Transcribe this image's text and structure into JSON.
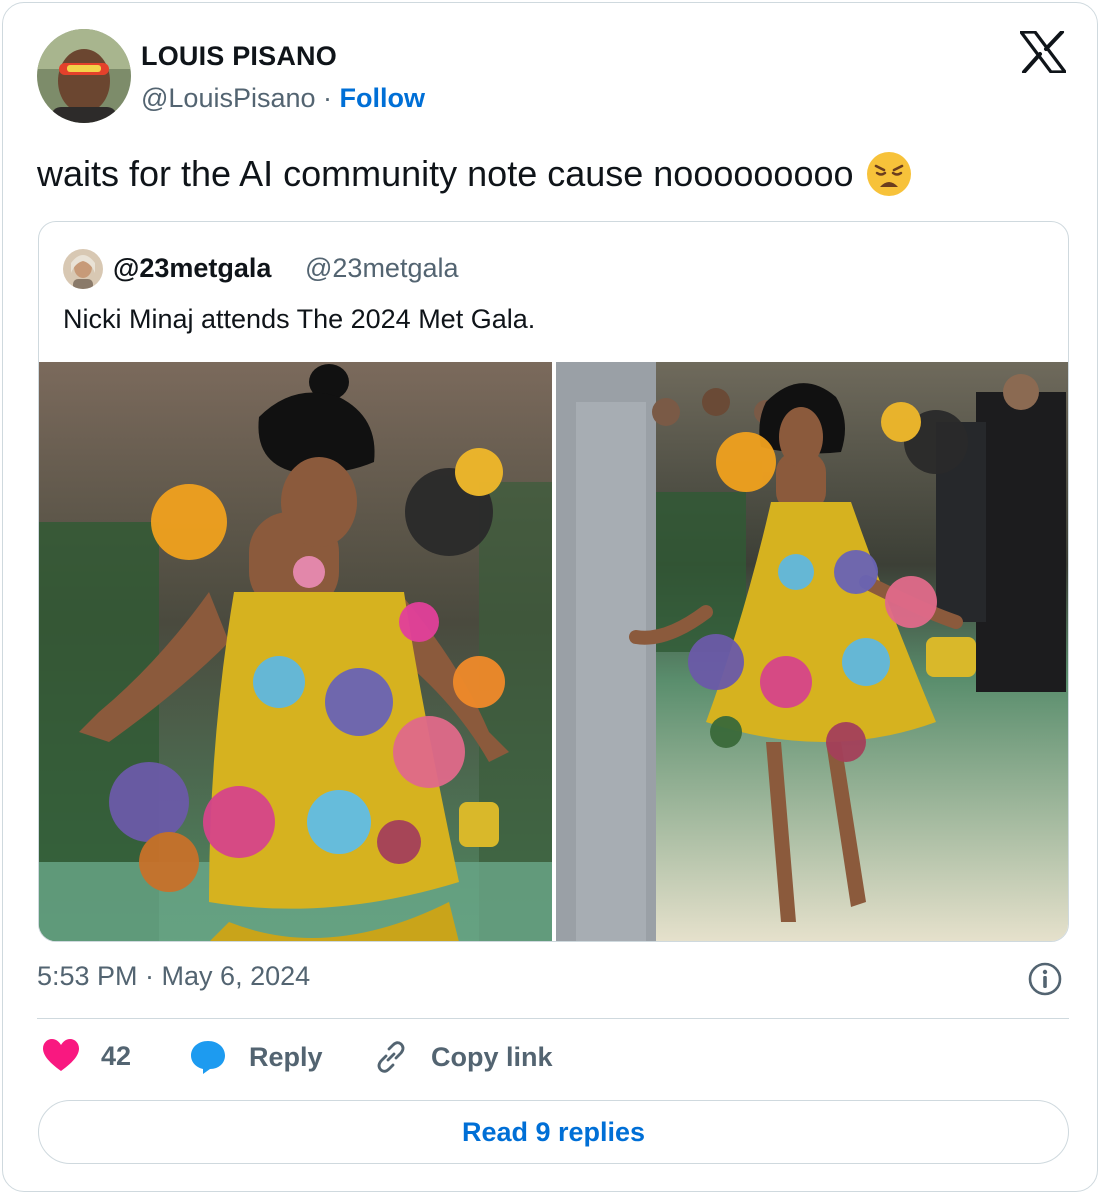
{
  "author": {
    "name": "LOUIS PISANO",
    "handle": "@LouisPisano",
    "separator": "·",
    "follow_label": "Follow"
  },
  "tweet": {
    "text": "waits for the AI community note cause nooooooooo",
    "emoji_icon": "weary-face-icon"
  },
  "quoted_tweet": {
    "name": "@23metgala",
    "handle": "@23metgala",
    "text": "Nicki Minaj attends The 2024 Met Gala.",
    "photos": [
      "photo-closeup-floral-dress",
      "photo-full-length-floral-dress"
    ]
  },
  "meta": {
    "timestamp": "5:53 PM · May 6, 2024"
  },
  "actions": {
    "like_count": "42",
    "reply_label": "Reply",
    "copy_link_label": "Copy link"
  },
  "read_replies_label": "Read 9 replies",
  "colors": {
    "accent": "#006fd6",
    "like": "#f91880",
    "reply_icon": "#1d9bf0",
    "secondary_text": "#536471",
    "border": "#cfd9de"
  }
}
